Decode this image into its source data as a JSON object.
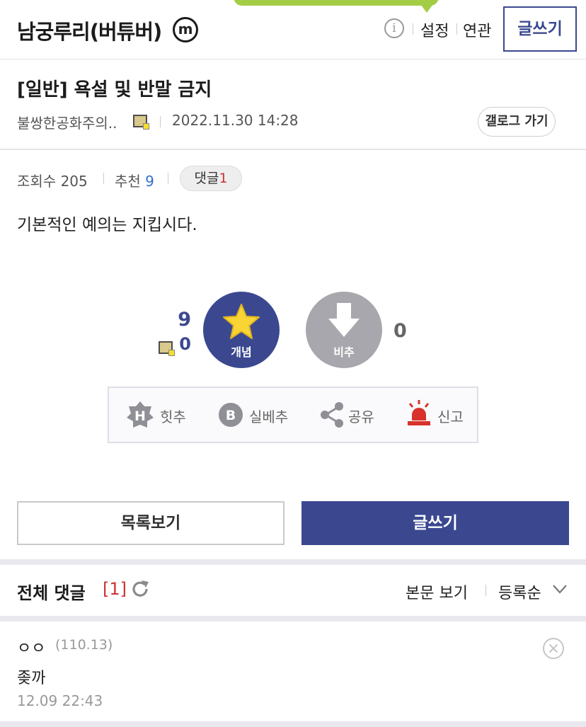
{
  "header": {
    "gallery_title": "남궁루리(버튜버)",
    "minor_badge": "m",
    "info_icon": "i",
    "settings": "설정",
    "related": "연관",
    "write": "글쓰기"
  },
  "post": {
    "title": "[일반] 욕설 및 반말 금지",
    "author": "불쌍한공화주의..",
    "date": "2022.11.30 14:28",
    "go_gallery": "갤로그 가기",
    "views_label": "조회수",
    "views": "205",
    "recommend_label": "추천",
    "recommend": "9",
    "comments_label": "댓글",
    "comments": "1",
    "content": "기본적인 예의는 지킵시다."
  },
  "vote": {
    "up_count": "9",
    "up_fixed_count": "0",
    "up_label": "개념",
    "down_label": "비추",
    "down_count": "0"
  },
  "actions": {
    "hit": "힛추",
    "best": "실베추",
    "share": "공유",
    "report": "신고"
  },
  "bottom": {
    "list": "목록보기",
    "write": "글쓰기"
  },
  "comments": {
    "title": "전체 댓글",
    "count": "[1]",
    "view_body": "본문 보기",
    "sort": "등록순",
    "items": [
      {
        "nick": "ㅇㅇ",
        "ip": "(110.13)",
        "text": "좆까",
        "time": "12.09 22:43"
      }
    ]
  },
  "colors": {
    "accent": "#3b4890",
    "notice_green": "#a4cd46",
    "report_red": "#d8322b"
  }
}
